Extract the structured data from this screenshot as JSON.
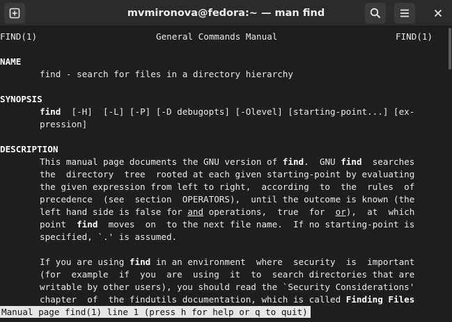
{
  "window": {
    "title": "mvmironova@fedora:~ — man find",
    "new_tab_icon": "new-tab-icon",
    "search_icon": "search-icon",
    "menu_icon": "hamburger-menu-icon",
    "close_icon": "close-icon"
  },
  "man": {
    "header_left": "FIND(1)",
    "header_center": "General Commands Manual",
    "header_right": "FIND(1)",
    "name_heading": "NAME",
    "name_line": "find - search for files in a directory hierarchy",
    "synopsis_heading": "SYNOPSIS",
    "synopsis_cmd": "find",
    "synopsis_rest": "  [-H]  [-L] [-P] [-D debugopts] [-Olevel] [starting-point...] [ex-",
    "synopsis_cont": "pression]",
    "description_heading": "DESCRIPTION",
    "desc_lines": [
      {
        "a": "This manual page documents the GNU version of ",
        "b": "find",
        "c": ".  GNU ",
        "d": "find",
        "e": "  searches"
      },
      {
        "a": "the  directory  tree  rooted at each given starting-point by evaluating"
      },
      {
        "a": "the given expression from left to right,  according  to  the  rules  of"
      },
      {
        "a": "precedence  (see  section  OPERATORS),  until the outcome is known (the"
      },
      {
        "a": "left hand side is false for ",
        "u1": "and",
        "c": " operations,  true  for  ",
        "u2": "or",
        "e": "),  at  which"
      },
      {
        "a": "point  ",
        "b": "find",
        "c": "  moves  on  to the next file name.  If no starting-point is"
      },
      {
        "a": "specified, `.' is assumed."
      },
      {
        "a": ""
      },
      {
        "a": "If you are using ",
        "b": "find",
        "c": " in an environment  where  security  is  important"
      },
      {
        "a": "(for  example  if  you  are  using  it  to  search directories that are"
      },
      {
        "a": "writable by other users), you should read the `Security Considerations'"
      },
      {
        "a": "chapter  of  the findutils documentation, which is called ",
        "b": "Finding Files"
      }
    ],
    "status": "Manual page find(1) line 1 (press h for help or q to quit)"
  }
}
